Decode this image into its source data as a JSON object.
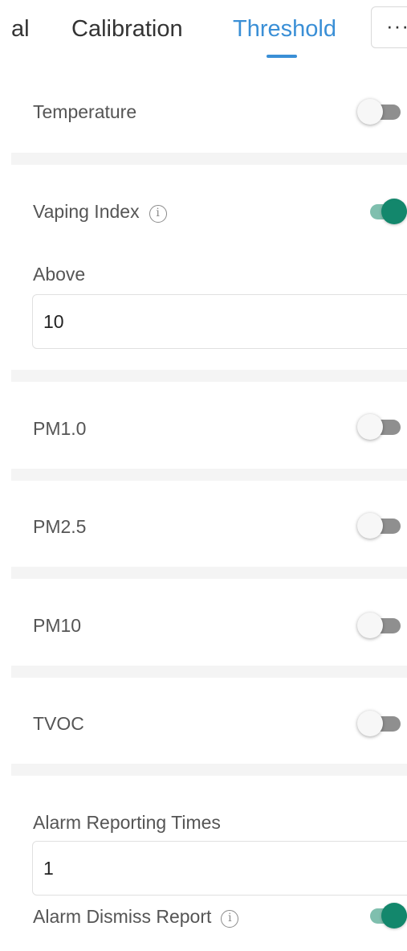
{
  "tabs": {
    "partial_label": "al",
    "calibration_label": "Calibration",
    "threshold_label": "Threshold",
    "more_label": "···"
  },
  "settings": {
    "temperature": {
      "label": "Temperature",
      "enabled": false
    },
    "vaping_index": {
      "label": "Vaping Index",
      "info_icon": "i",
      "enabled": true,
      "above_label": "Above",
      "above_value": "10"
    },
    "pm1_0": {
      "label": "PM1.0",
      "enabled": false
    },
    "pm2_5": {
      "label": "PM2.5",
      "enabled": false
    },
    "pm10": {
      "label": "PM10",
      "enabled": false
    },
    "tvoc": {
      "label": "TVOC",
      "enabled": false
    },
    "alarm_reporting_times": {
      "label": "Alarm Reporting Times",
      "value": "1"
    },
    "alarm_dismiss_report": {
      "label": "Alarm Dismiss Report",
      "info_icon": "i",
      "enabled": true
    }
  },
  "colors": {
    "accent": "#3a8fd6",
    "toggle_on": "#13876c",
    "toggle_on_track": "#7fbfae",
    "toggle_off_track": "#8f8f8f"
  }
}
